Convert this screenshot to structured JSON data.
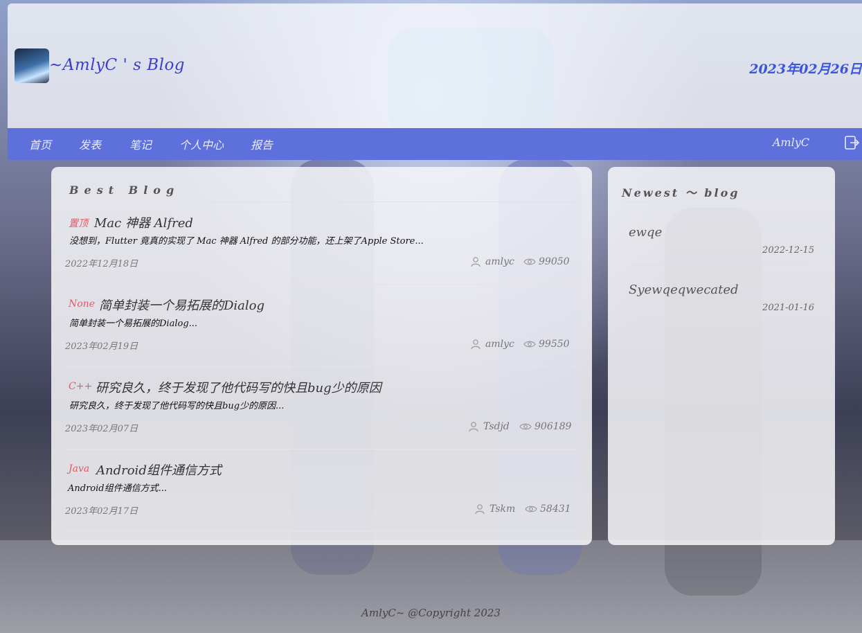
{
  "header": {
    "site_title": "~AmlyC ' s Blog",
    "date": "2023年02月26日"
  },
  "nav": {
    "items": [
      {
        "label": "首页"
      },
      {
        "label": "发表"
      },
      {
        "label": "笔记"
      },
      {
        "label": "个人中心"
      },
      {
        "label": "报告"
      }
    ],
    "user": "AmlyC"
  },
  "best_blog": {
    "title": "Best Blog",
    "posts": [
      {
        "tag": "置顶",
        "title": "Mac 神器 Alfred",
        "excerpt": "没想到，Flutter 竟真的实现了 Mac 神器 Alfred 的部分功能，还上架了Apple Store...",
        "date": "2022年12月18日",
        "author": "amlyc",
        "views": "99050"
      },
      {
        "tag": "None",
        "title": "简单封装一个易拓展的Dialog",
        "excerpt": "简单封装一个易拓展的Dialog...",
        "date": "2023年02月19日",
        "author": "amlyc",
        "views": "99550"
      },
      {
        "tag": "C++",
        "title": "研究良久，终于发现了他代码写的快且bug少的原因",
        "excerpt": "研究良久，终于发现了他代码写的快且bug少的原因...",
        "date": "2023年02月07日",
        "author": "Tsdjd",
        "views": "906189"
      },
      {
        "tag": "Java",
        "title": "Android组件通信方式",
        "excerpt": "Android组件通信方式...",
        "date": "2023年02月17日",
        "author": "Tskm",
        "views": "58431"
      }
    ]
  },
  "newest": {
    "title": "Newest ～ blog",
    "items": [
      {
        "title": "ewqe",
        "date": "2022-12-15"
      },
      {
        "title": "Syewqeqwecated",
        "date": "2021-01-16"
      }
    ]
  },
  "footer": {
    "text": "AmlyC~ @Copyright 2023"
  },
  "colors": {
    "nav": "#5d70dc",
    "title": "#3b3fcc",
    "date": "#3a55e0",
    "tag": "#e05a6a"
  },
  "icons": [
    "logo-image",
    "logout-icon",
    "user-icon",
    "eye-icon"
  ]
}
